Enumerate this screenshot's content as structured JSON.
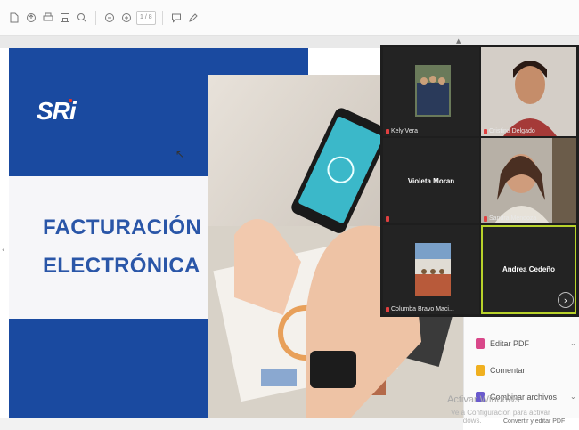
{
  "toolbar": {
    "icons": [
      "file-icon",
      "share-icon",
      "print-icon",
      "save-icon",
      "search-icon",
      "zoom-out-icon",
      "zoom-in-icon",
      "comment-icon",
      "pen-icon"
    ],
    "page_current": "1",
    "page_total": "/ 8"
  },
  "slide": {
    "logo": "SRi",
    "title_line1": "FACTURACIÓN",
    "title_line2": "ELECTRÓNICA",
    "colors": {
      "blue": "#1a4aa0",
      "title": "#2a56a8"
    }
  },
  "side_panel": {
    "items": [
      {
        "label": "Editar PDF",
        "icon": "edit-pdf-icon",
        "color": "#d9488a"
      },
      {
        "label": "Comentar",
        "icon": "comment-icon",
        "color": "#f0b020"
      },
      {
        "label": "Combinar archivos",
        "icon": "combine-icon",
        "color": "#6a5acd"
      }
    ],
    "watermark_title": "Activar Windows",
    "watermark_subtitle": "Ve a Configuración para activar Windows.",
    "bottom_link": "Convertir y editar PDF"
  },
  "meeting": {
    "participants": [
      {
        "name": "Kely Vera",
        "video": "group-photo"
      },
      {
        "name": "Cristina Delgado",
        "video": "camera"
      },
      {
        "name": "Violeta Moran",
        "video": "off"
      },
      {
        "name": "Sandra Mendoza",
        "video": "camera"
      },
      {
        "name": "Columba Bravo Maci...",
        "video": "group-photo"
      },
      {
        "name": "Andrea Cedeño",
        "video": "off",
        "active_speaker": true
      }
    ],
    "next_page_icon": "chevron-right-icon"
  }
}
